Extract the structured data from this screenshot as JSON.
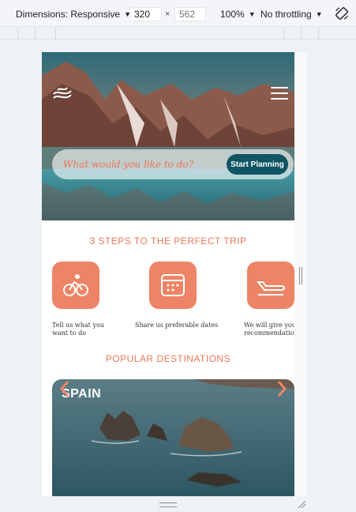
{
  "devtools": {
    "dimensions_label": "Dimensions: Responsive",
    "width": "320",
    "times": "×",
    "height": "562",
    "zoom": "100%",
    "throttling": "No throttling"
  },
  "hero": {
    "search_placeholder": "What would you like to do?",
    "plan_button": "Start Planning"
  },
  "steps": {
    "title": "3 STEPS TO THE PERFECT TRIP",
    "items": [
      {
        "icon": "bicycle-icon",
        "line1": "Tell us what you",
        "line2": "want to do"
      },
      {
        "icon": "calendar-icon",
        "line1": "Share us preferable dates",
        "line2": ""
      },
      {
        "icon": "plane-icon",
        "line1": "We will give you",
        "line2": "recommendation"
      }
    ]
  },
  "destinations": {
    "title": "POPULAR DESTINATIONS",
    "card_title": "SPAIN"
  },
  "colors": {
    "accent": "#e9785a",
    "icon_tile": "#ee8466",
    "button": "#0f5563"
  }
}
